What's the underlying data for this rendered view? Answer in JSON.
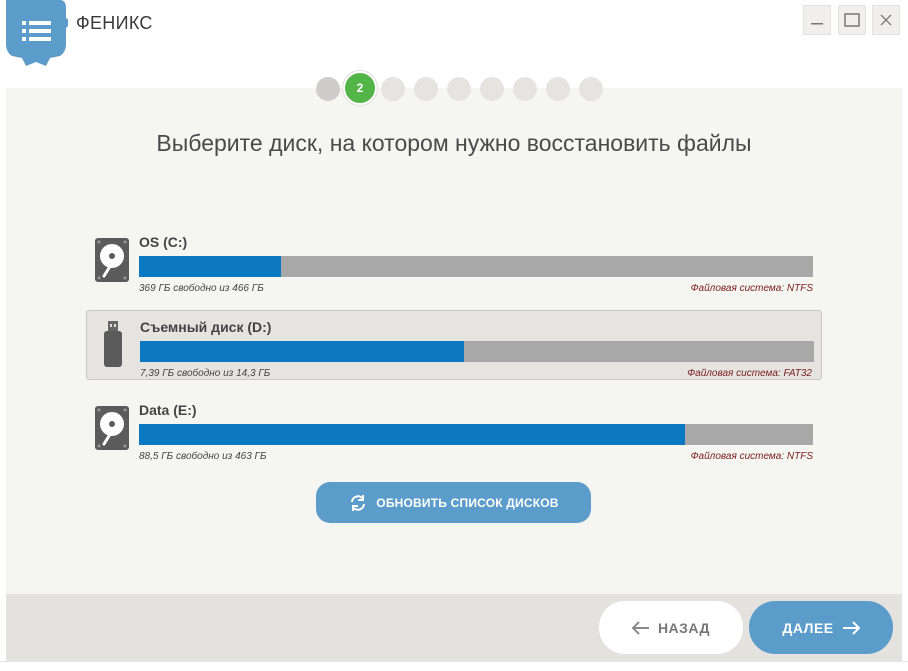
{
  "window": {
    "title": "ФЕНИКС",
    "logo_icon": "menu-gear-icon",
    "controls": [
      "minimize-icon",
      "maximize-icon",
      "close-icon"
    ]
  },
  "stepper": {
    "current_label": "2",
    "total_steps": 9,
    "current_step": 2,
    "active_color": "#53b447"
  },
  "heading": "Выберите диск, на котором нужно восстановить файлы",
  "disks": [
    {
      "name": "OS (C:)",
      "icon": "hard-disk-icon",
      "free_text": "369 ГБ свободно из 466 ГБ",
      "fs_text": "Файловая система: NTFS",
      "used_fraction": 0.21,
      "selected": false
    },
    {
      "name": "Съемный диск (D:)",
      "icon": "usb-drive-icon",
      "free_text": "7,39 ГБ свободно из 14,3 ГБ",
      "fs_text": "Файловая система: FAT32",
      "used_fraction": 0.48,
      "selected": true
    },
    {
      "name": "Data (E:)",
      "icon": "hard-disk-icon",
      "free_text": "88,5 ГБ свободно из 463 ГБ",
      "fs_text": "Файловая система: NTFS",
      "used_fraction": 0.81,
      "selected": false
    }
  ],
  "refresh_button": {
    "label": "ОБНОВИТЬ СПИСОК ДИСКОВ",
    "icon": "refresh-icon"
  },
  "footer": {
    "back_label": "НАЗАД",
    "next_label": "ДАЛЕЕ",
    "back_icon": "arrow-left-icon",
    "next_icon": "arrow-right-icon"
  },
  "colors": {
    "accent": "#5b9ccb",
    "bar_fill": "#0b78c1",
    "bar_bg": "#a8a8a8",
    "fs_text": "#7a1d1d"
  }
}
